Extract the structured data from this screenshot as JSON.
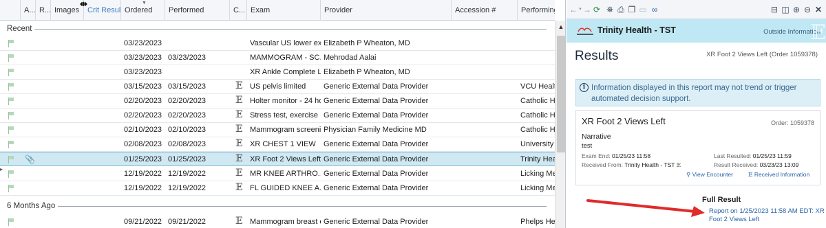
{
  "grid": {
    "columns": [
      "A...",
      "R...",
      "Images",
      "Crit Result",
      "Ordered",
      "Performed",
      "C...",
      "Exam",
      "Provider",
      "Accession #",
      "Performing"
    ],
    "groups": [
      {
        "label": "Recent",
        "rows": [
          {
            "ordered": "03/23/2023",
            "performed": "",
            "ext": false,
            "exam": "Vascular US lower ex...",
            "provider": "Elizabeth P Wheaton, MD",
            "accession": "",
            "performing": ""
          },
          {
            "ordered": "03/23/2023",
            "performed": "03/23/2023",
            "ext": false,
            "exam": "MAMMOGRAM - SC...",
            "provider": "Mehrodad Aalai",
            "accession": "",
            "performing": ""
          },
          {
            "ordered": "03/23/2023",
            "performed": "",
            "ext": false,
            "exam": "XR Ankle Complete Left",
            "provider": "Elizabeth P Wheaton, MD",
            "accession": "",
            "performing": ""
          },
          {
            "ordered": "03/15/2023",
            "performed": "03/15/2023",
            "ext": true,
            "exam": "US pelvis limited",
            "provider": "Generic External Data Provider",
            "accession": "",
            "performing": "VCU Health"
          },
          {
            "ordered": "02/20/2023",
            "performed": "02/20/2023",
            "ext": true,
            "exam": "Holter monitor - 24 hour",
            "provider": "Generic External Data Provider",
            "accession": "",
            "performing": "Catholic He"
          },
          {
            "ordered": "02/20/2023",
            "performed": "02/20/2023",
            "ext": true,
            "exam": "Stress test, exercise",
            "provider": "Generic External Data Provider",
            "accession": "",
            "performing": "Catholic He"
          },
          {
            "ordered": "02/10/2023",
            "performed": "02/10/2023",
            "ext": true,
            "exam": "Mammogram screeni...",
            "provider": "Physician Family Medicine MD",
            "accession": "",
            "performing": "Catholic He"
          },
          {
            "ordered": "02/08/2023",
            "performed": "02/08/2023",
            "ext": true,
            "exam": "XR CHEST 1 VIEW",
            "provider": "Generic External Data Provider",
            "accession": "",
            "performing": "University H"
          },
          {
            "ordered": "01/25/2023",
            "performed": "01/25/2023",
            "ext": true,
            "exam": "XR Foot 2 Views Left",
            "provider": "Generic External Data Provider",
            "accession": "",
            "performing": "Trinity Heal",
            "selected": true,
            "attachment": true
          },
          {
            "ordered": "12/19/2022",
            "performed": "12/19/2022",
            "ext": true,
            "exam": "MR KNEE ARTHRO...",
            "provider": "Generic External Data Provider",
            "accession": "",
            "performing": "Licking Mer"
          },
          {
            "ordered": "12/19/2022",
            "performed": "12/19/2022",
            "ext": true,
            "exam": "FL GUIDED KNEE A...",
            "provider": "Generic External Data Provider",
            "accession": "",
            "performing": "Licking Mer"
          }
        ]
      },
      {
        "label": "6 Months Ago",
        "rows": [
          {
            "ordered": "09/21/2022",
            "performed": "09/21/2022",
            "ext": true,
            "exam": "Mammogram breast d...",
            "provider": "Generic External Data Provider",
            "accession": "",
            "performing": "Phelps Hea"
          }
        ]
      }
    ]
  },
  "panel": {
    "banner": {
      "org": "Trinity Health - TST",
      "outside": "Outside Information"
    },
    "results_title": "Results",
    "results_sub": "XR Foot 2 Views Left (Order 1059378)",
    "info": "Information displayed in this report may not trend or trigger automated decision support.",
    "report": {
      "title": "XR Foot 2 Views Left",
      "order": "Order: 1059378",
      "narrative_label": "Narrative",
      "narrative_text": "test",
      "exam_end_label": "Exam End:",
      "exam_end": "01/25/23 11:58",
      "last_resulted_label": "Last Resulted:",
      "last_resulted": "01/25/23 11:59",
      "received_from_label": "Received From:",
      "received_from": "Trinity Health - TST",
      "result_received_label": "Result Received:",
      "result_received": "03/23/23 13:09",
      "view_encounter": "View Encounter",
      "received_information": "Received Information"
    },
    "full_result_label": "Full Result",
    "report_link": "Report on 1/25/2023 11:58 AM EDT: XR Foot 2 Views Left"
  },
  "colors": {
    "selected_row": "#cfe8f2",
    "banner": "#bfe8f4",
    "info_box": "#dceef6",
    "link": "#2b64a8",
    "annotation_arrow": "#e02b2b"
  }
}
